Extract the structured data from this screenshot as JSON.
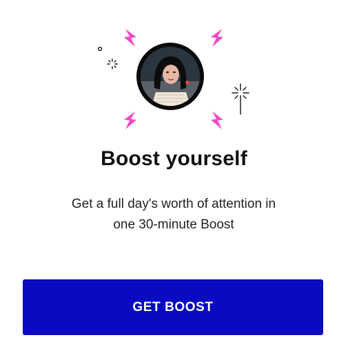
{
  "boost_card": {
    "title": "Boost yourself",
    "description_line_1": "Get a full day's worth of attention in",
    "description_line_2": "one 30-minute Boost",
    "cta_label": "GET BOOST"
  },
  "illustration": {
    "accent_color": "#f04bc2",
    "ring_color": "#0b0b0b",
    "icons": [
      "lightning-bolt-icon",
      "sparkle-icon",
      "avatar"
    ]
  },
  "colors": {
    "button_background": "#0a0ac2",
    "button_text": "#ffffff",
    "title_text": "#111111",
    "body_text": "#222222"
  }
}
